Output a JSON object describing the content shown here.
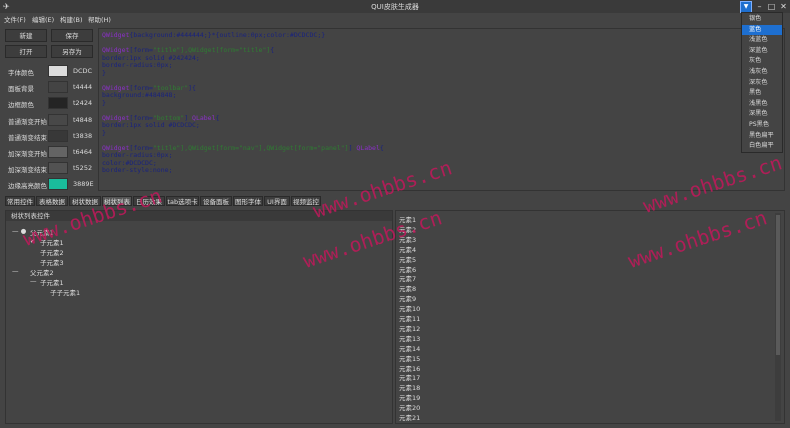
{
  "window": {
    "title": "QUI皮肤生成器",
    "app_icon": "airplane-icon",
    "min": "–",
    "max": "□",
    "close": "✕"
  },
  "skin_button": "▼",
  "menus": [
    "文件(F)",
    "编辑(E)",
    "构建(B)",
    "帮助(H)"
  ],
  "buttons": {
    "new": "新建",
    "save": "保存",
    "open": "打开",
    "save_as": "另存为"
  },
  "color_rows": [
    {
      "label": "字体颜色",
      "value": "DCDC",
      "color": "#DCDCDC"
    },
    {
      "label": "面板背景",
      "value": "t4444",
      "color": "#444444"
    },
    {
      "label": "边框颜色",
      "value": "t2424",
      "color": "#242424"
    },
    {
      "label": "普通渐变开始",
      "value": "t4848",
      "color": "#484848"
    },
    {
      "label": "普通渐变结束",
      "value": "t3838",
      "color": "#383838"
    },
    {
      "label": "加深渐变开始",
      "value": "t6464",
      "color": "#646464"
    },
    {
      "label": "加深渐变结束",
      "value": "t5252",
      "color": "#525252"
    },
    {
      "label": "边缘高亮颜色",
      "value": "3889E",
      "color": "#1ABC9C"
    }
  ],
  "editor_lines": [
    [
      {
        "t": "QWidget",
        "c": "kw"
      },
      {
        "t": "{background:",
        "c": "prop"
      },
      {
        "t": "#444444",
        "c": "val"
      },
      {
        "t": ";}*{",
        "c": "prop"
      },
      {
        "t": "outline:",
        "c": "prop"
      },
      {
        "t": "0px",
        "c": "val"
      },
      {
        "t": ";color:",
        "c": "prop"
      },
      {
        "t": "#DCDCDC",
        "c": "val"
      },
      {
        "t": ";}",
        "c": "prop"
      }
    ],
    [],
    [
      {
        "t": "QWidget",
        "c": "kw"
      },
      {
        "t": "[form=",
        "c": "prop"
      },
      {
        "t": "\"title\"],QWidget[form=\"title\"]",
        "c": "str"
      },
      {
        "t": "{",
        "c": "prop"
      }
    ],
    [
      {
        "t": "border:",
        "c": "prop"
      },
      {
        "t": "1px solid #242424;",
        "c": "val"
      }
    ],
    [
      {
        "t": "border-radius:",
        "c": "prop"
      },
      {
        "t": "0px;",
        "c": "val"
      }
    ],
    [
      {
        "t": "}",
        "c": "prop"
      }
    ],
    [],
    [
      {
        "t": "QWidget",
        "c": "kw"
      },
      {
        "t": "[form=",
        "c": "prop"
      },
      {
        "t": "\"toolbar\"",
        "c": "str"
      },
      {
        "t": "]{",
        "c": "prop"
      }
    ],
    [
      {
        "t": "background:",
        "c": "prop"
      },
      {
        "t": "#484848;",
        "c": "val"
      }
    ],
    [
      {
        "t": "}",
        "c": "prop"
      }
    ],
    [],
    [
      {
        "t": "QWidget",
        "c": "kw"
      },
      {
        "t": "[form=",
        "c": "prop"
      },
      {
        "t": "\"bottom\"",
        "c": "str"
      },
      {
        "t": "] ",
        "c": "prop"
      },
      {
        "t": "QLabel",
        "c": "kw"
      },
      {
        "t": "{",
        "c": "prop"
      }
    ],
    [
      {
        "t": "border:",
        "c": "prop"
      },
      {
        "t": "1px solid #DCDCDC;",
        "c": "val"
      }
    ],
    [
      {
        "t": "}",
        "c": "prop"
      }
    ],
    [],
    [
      {
        "t": "QWidget",
        "c": "kw"
      },
      {
        "t": "[form=",
        "c": "prop"
      },
      {
        "t": "\"title\"],QWidget[form=\"nav\"],QWidget[form=\"panel\"]",
        "c": "str"
      },
      {
        "t": "] ",
        "c": "prop"
      },
      {
        "t": "QLabel",
        "c": "kw"
      },
      {
        "t": "{",
        "c": "prop"
      }
    ],
    [
      {
        "t": "border-radius:",
        "c": "prop"
      },
      {
        "t": "0px;",
        "c": "val"
      }
    ],
    [
      {
        "t": "color:",
        "c": "prop"
      },
      {
        "t": "#DCDCDC;",
        "c": "val"
      }
    ],
    [
      {
        "t": "border-style:",
        "c": "prop"
      },
      {
        "t": "none;",
        "c": "val"
      }
    ]
  ],
  "tabs": [
    "常用控件",
    "表格数据",
    "树状数据",
    "树状列表",
    "日历效果",
    "tab选项卡",
    "设备面板",
    "图形字体",
    "UI界面",
    "视频监控"
  ],
  "active_tab": 3,
  "tree": {
    "header": "树状列表控件",
    "nodes": [
      {
        "text": "父元素1",
        "prefix": "—  ●",
        "level": 0
      },
      {
        "text": "子元素1",
        "prefix": "✔",
        "level": 1
      },
      {
        "text": "子元素2",
        "prefix": "",
        "level": 1
      },
      {
        "text": "子元素3",
        "prefix": "",
        "level": 1
      },
      {
        "text": "父元素2",
        "prefix": "—",
        "level": 0
      },
      {
        "text": "子元素1",
        "prefix": "—",
        "level": 1
      },
      {
        "text": "子子元素1",
        "prefix": "",
        "level": 2
      }
    ]
  },
  "list_items": [
    "元素1",
    "元素2",
    "元素3",
    "元素4",
    "元素5",
    "元素6",
    "元素7",
    "元素8",
    "元素9",
    "元素10",
    "元素11",
    "元素12",
    "元素13",
    "元素14",
    "元素15",
    "元素16",
    "元素17",
    "元素18",
    "元素19",
    "元素20",
    "元素21"
  ],
  "skins": [
    "银色",
    "蓝色",
    "浅蓝色",
    "深蓝色",
    "灰色",
    "浅灰色",
    "深灰色",
    "黑色",
    "浅黑色",
    "深黑色",
    "PS黑色",
    "黑色扁平",
    "白色扁平"
  ],
  "active_skin": 1,
  "watermark": "www.ohbbs.cn",
  "colors": {
    "accent": "#1e6fd0",
    "watermark": "#c2185b"
  }
}
